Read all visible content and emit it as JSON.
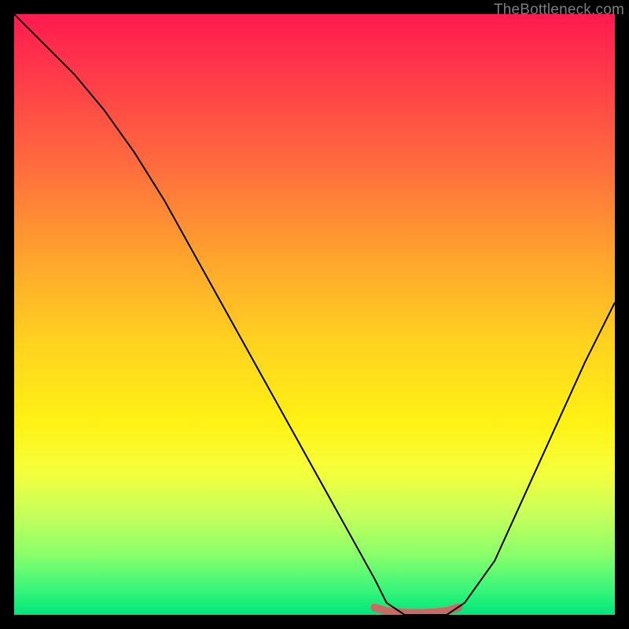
{
  "watermark": {
    "text": "TheBottleneck.com"
  },
  "chart_data": {
    "type": "line",
    "title": "",
    "xlabel": "",
    "ylabel": "",
    "xlim": [
      0,
      100
    ],
    "ylim": [
      0,
      100
    ],
    "series": [
      {
        "name": "bottleneck-curve",
        "x": [
          0,
          5,
          10,
          15,
          20,
          25,
          30,
          35,
          40,
          45,
          50,
          55,
          60,
          62,
          65,
          68,
          70,
          72,
          75,
          80,
          85,
          90,
          95,
          100
        ],
        "values": [
          100,
          95,
          90,
          84,
          77,
          69,
          60,
          51,
          42,
          33,
          24,
          15,
          6,
          2,
          0,
          0,
          0,
          0,
          2,
          9,
          20,
          31,
          42,
          52
        ]
      },
      {
        "name": "flat-floor-marker",
        "x": [
          60,
          62,
          64,
          66,
          68,
          70,
          72,
          74
        ],
        "values": [
          1.2,
          0.6,
          0.4,
          0.3,
          0.3,
          0.4,
          0.6,
          1.2
        ]
      }
    ],
    "colors": {
      "curve": "#000000",
      "floor_marker": "#c96a64",
      "bg_top": "#ff1a4f",
      "bg_bottom": "#00e57a"
    },
    "grid": false,
    "legend_position": "none"
  }
}
